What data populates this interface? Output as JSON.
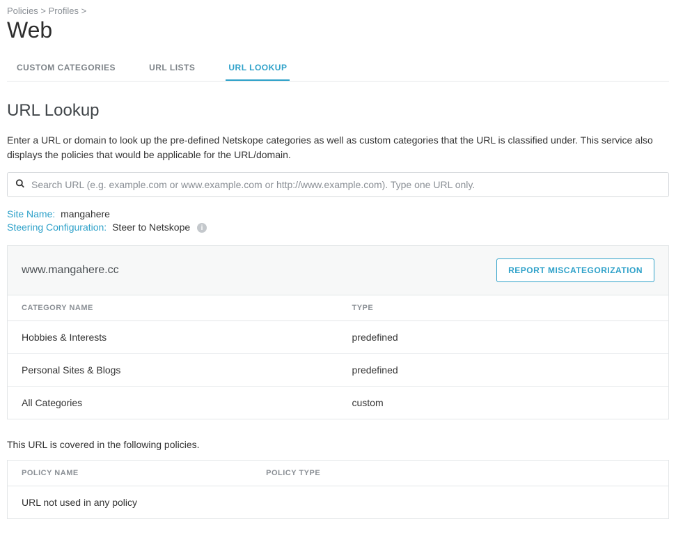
{
  "breadcrumb": {
    "p1": "Policies",
    "p2": "Profiles",
    "sep": ">"
  },
  "page_title": "Web",
  "tabs": {
    "custom": "CUSTOM CATEGORIES",
    "urllists": "URL LISTS",
    "urllookup": "URL LOOKUP"
  },
  "section_title": "URL Lookup",
  "intro": "Enter a URL or domain to look up the pre-defined Netskope categories as well as custom categories that the URL is classified under. This service also displays the policies that would be applicable for the URL/domain.",
  "search": {
    "placeholder": "Search URL (e.g. example.com or www.example.com or http://www.example.com). Type one URL only."
  },
  "meta": {
    "site_name_label": "Site Name:",
    "site_name_value": "mangahere",
    "steering_label": "Steering Configuration:",
    "steering_value": "Steer to Netskope"
  },
  "result": {
    "domain": "www.mangahere.cc",
    "report_button": "REPORT MISCATEGORIZATION",
    "columns": {
      "name": "CATEGORY NAME",
      "type": "TYPE"
    },
    "rows": [
      {
        "name": "Hobbies & Interests",
        "type": "predefined"
      },
      {
        "name": "Personal Sites & Blogs",
        "type": "predefined"
      },
      {
        "name": "All Categories",
        "type": "custom"
      }
    ]
  },
  "policies": {
    "intro": "This URL is covered in the following policies.",
    "columns": {
      "name": "POLICY NAME",
      "type": "POLICY TYPE"
    },
    "empty": "URL not used in any policy"
  }
}
